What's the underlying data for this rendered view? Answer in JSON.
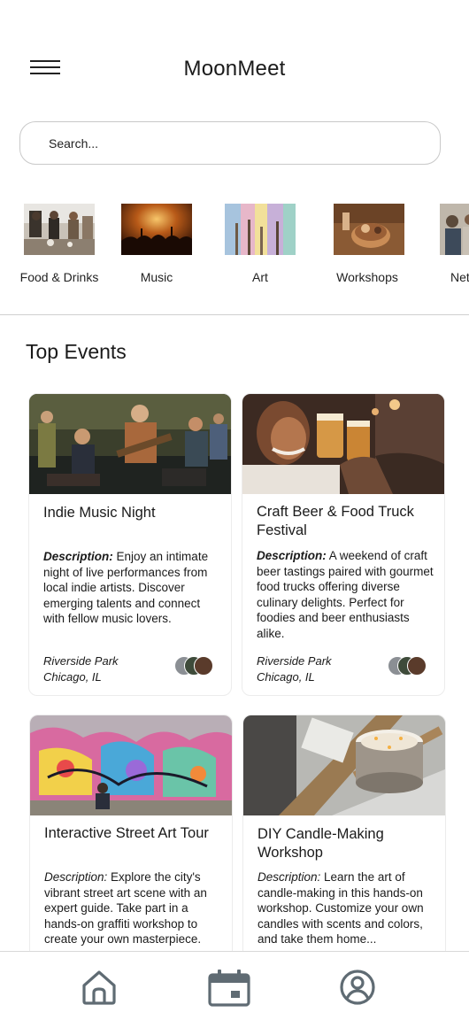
{
  "header": {
    "title": "MoonMeet"
  },
  "search": {
    "placeholder": "Search..."
  },
  "categories": [
    {
      "label": "Food & Drinks"
    },
    {
      "label": "Music"
    },
    {
      "label": "Art"
    },
    {
      "label": "Workshops"
    },
    {
      "label": "Net"
    }
  ],
  "section": {
    "title": "Top Events"
  },
  "events": [
    {
      "title": "Indie Music Night",
      "desc_label": "Description:",
      "desc": " Enjoy an intimate night of live performances from local indie artists. Discover emerging talents and connect with fellow music lovers.",
      "loc_line1": "Riverside Park",
      "loc_line2": "Chicago, IL"
    },
    {
      "title": "Craft Beer & Food Truck Festival",
      "desc_label": "Description:",
      "desc": " A weekend of craft beer tastings paired with gourmet food trucks offering diverse culinary delights. Perfect for foodies and beer enthusiasts alike.",
      "loc_line1": "Riverside Park",
      "loc_line2": "Chicago, IL"
    },
    {
      "title": "Interactive Street Art Tour",
      "desc_label": "Description:",
      "desc": " Explore the city's vibrant street art scene with an expert guide. Take part in a hands-on graffiti workshop to create your own masterpiece."
    },
    {
      "title": "DIY Candle-Making Workshop",
      "desc_label": "Description:",
      "desc": " Learn the art of candle-making in this hands-on workshop. Customize your own candles with scents and colors, and take them home..."
    }
  ],
  "nav": {
    "icons": [
      "home-icon",
      "calendar-icon",
      "profile-icon"
    ],
    "color": "#5f6b73"
  }
}
